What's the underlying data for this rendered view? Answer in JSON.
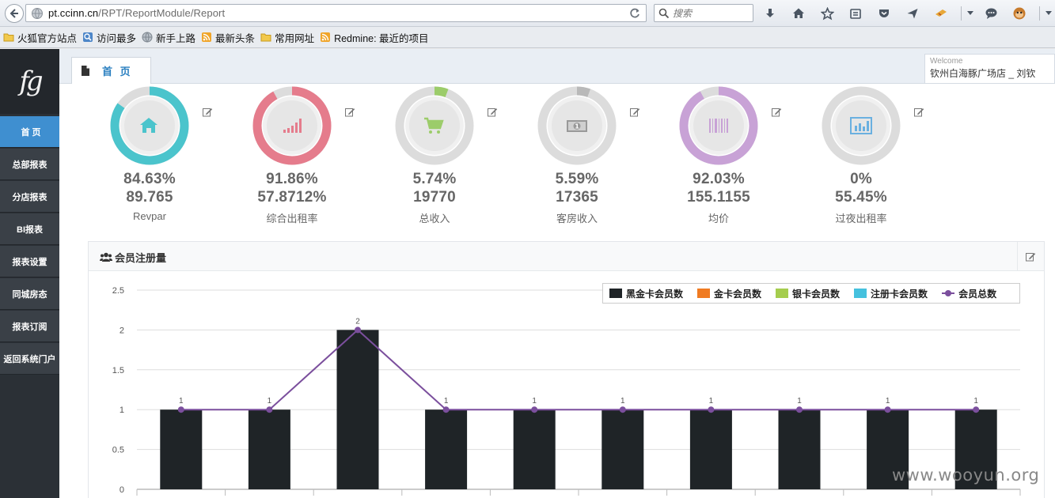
{
  "browser": {
    "url_host": "pt.ccinn.cn",
    "url_path": "/RPT/ReportModule/Report",
    "search_placeholder": "搜索"
  },
  "bookmarks": [
    {
      "label": "火狐官方站点",
      "icon": "folder-icon"
    },
    {
      "label": "访问最多",
      "icon": "magnifier-icon"
    },
    {
      "label": "新手上路",
      "icon": "globe-icon"
    },
    {
      "label": "最新头条",
      "icon": "rss-icon"
    },
    {
      "label": "常用网址",
      "icon": "folder-icon"
    },
    {
      "label": "Redmine: 最近的项目",
      "icon": "rss-icon"
    }
  ],
  "sidebar": {
    "logo": "fg",
    "items": [
      {
        "label": "首 页",
        "active": true
      },
      {
        "label": "总部报表"
      },
      {
        "label": "分店报表"
      },
      {
        "label": "BI报表"
      },
      {
        "label": "报表设置"
      },
      {
        "label": "同城房态"
      },
      {
        "label": "报表订阅"
      },
      {
        "label": "返回系统门户"
      }
    ]
  },
  "tab": {
    "label": "首 页"
  },
  "welcome": {
    "title": "Welcome",
    "user": "钦州白海豚广场店 _ 刘钦"
  },
  "kpis": [
    {
      "value1": "84.63%",
      "value2": "89.765",
      "label": "Revpar",
      "percent": 84.63,
      "color": "#4bc4cc",
      "icon": "house-icon"
    },
    {
      "value1": "91.86%",
      "value2": "57.8712%",
      "label": "综合出租率",
      "percent": 91.86,
      "color": "#e57c8c",
      "icon": "bar-chart-icon"
    },
    {
      "value1": "5.74%",
      "value2": "19770",
      "label": "总收入",
      "percent": 5.74,
      "color": "#9ccc6a",
      "icon": "cart-icon"
    },
    {
      "value1": "5.59%",
      "value2": "17365",
      "label": "客房收入",
      "percent": 5.59,
      "color": "#b9b9b9",
      "icon": "money-icon"
    },
    {
      "value1": "92.03%",
      "value2": "155.1155",
      "label": "均价",
      "percent": 92.03,
      "color": "#c8a2d6",
      "icon": "barcode-icon"
    },
    {
      "value1": "0%",
      "value2": "55.45%",
      "label": "过夜出租率",
      "percent": 0,
      "color": "#6ab0e0",
      "icon": "chart-box-icon"
    }
  ],
  "panel": {
    "title": "会员注册量"
  },
  "chart_data": {
    "type": "bar",
    "categories": [
      "",
      "",
      "",
      "",
      "",
      "",
      "",
      "",
      "",
      ""
    ],
    "series": [
      {
        "name": "黑金卡会员数",
        "color": "#1f2427",
        "values": [
          1,
          1,
          2,
          1,
          1,
          1,
          1,
          1,
          1,
          1
        ]
      },
      {
        "name": "金卡会员数",
        "color": "#f07b22",
        "values": [
          0,
          0,
          0,
          0,
          0,
          0,
          0,
          0,
          0,
          0
        ]
      },
      {
        "name": "银卡会员数",
        "color": "#a5cd4e",
        "values": [
          0,
          0,
          0,
          0,
          0,
          0,
          0,
          0,
          0,
          0
        ]
      },
      {
        "name": "注册卡会员数",
        "color": "#45c1de",
        "values": [
          0,
          0,
          0,
          0,
          0,
          0,
          0,
          0,
          0,
          0
        ]
      },
      {
        "name": "会员总数",
        "color": "#7b4f9d",
        "type": "line",
        "values": [
          1,
          1,
          2,
          1,
          1,
          1,
          1,
          1,
          1,
          1
        ]
      }
    ],
    "data_labels": [
      "1",
      "1",
      "2",
      "1",
      "1",
      "1",
      "1",
      "1",
      "1",
      "1"
    ],
    "yticks": [
      "0",
      "0.5",
      "1",
      "1.5",
      "2",
      "2.5"
    ],
    "ylim": [
      0,
      2.5
    ],
    "grid": true,
    "legend_position": "top-right"
  },
  "watermark": "www.wooyun.org"
}
